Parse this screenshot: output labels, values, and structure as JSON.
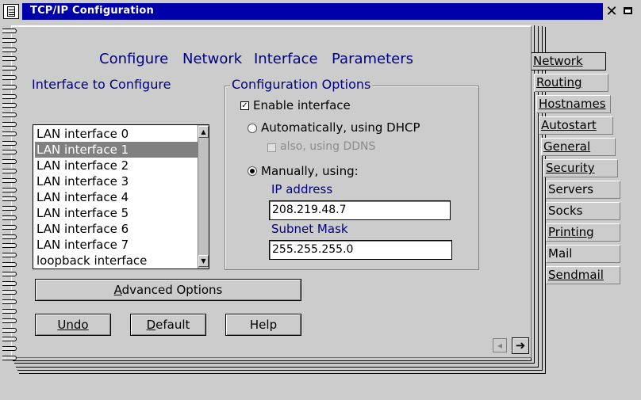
{
  "window": {
    "title": "TCP/IP Configuration"
  },
  "page": {
    "heading": [
      "Configure",
      "Network",
      "Interface",
      "Parameters"
    ]
  },
  "interface_list": {
    "label": "Interface to Configure",
    "items": [
      "LAN interface 0",
      "LAN interface 1",
      "LAN interface 2",
      "LAN interface 3",
      "LAN interface 4",
      "LAN interface 5",
      "LAN interface 6",
      "LAN interface 7",
      "loopback interface"
    ],
    "selected": "LAN interface 1"
  },
  "config": {
    "group_title": "Configuration Options",
    "enable_label": "Enable interface",
    "enable_checked": true,
    "dhcp_label": "Automatically, using DHCP",
    "ddns_label": "also, using DDNS",
    "manual_label": "Manually, using:",
    "ip_label": "IP address",
    "ip_value": "208.219.48.7",
    "mask_label": "Subnet Mask",
    "mask_value": "255.255.255.0"
  },
  "buttons": {
    "advanced": "Advanced Options",
    "undo": "Undo",
    "default": "Default",
    "help": "Help"
  },
  "tabs": [
    "Network",
    "Routing",
    "Hostnames",
    "Autostart",
    "General",
    "Security",
    "Servers",
    "Socks",
    "Printing",
    "Mail",
    "Sendmail"
  ],
  "active_tab": "Network"
}
